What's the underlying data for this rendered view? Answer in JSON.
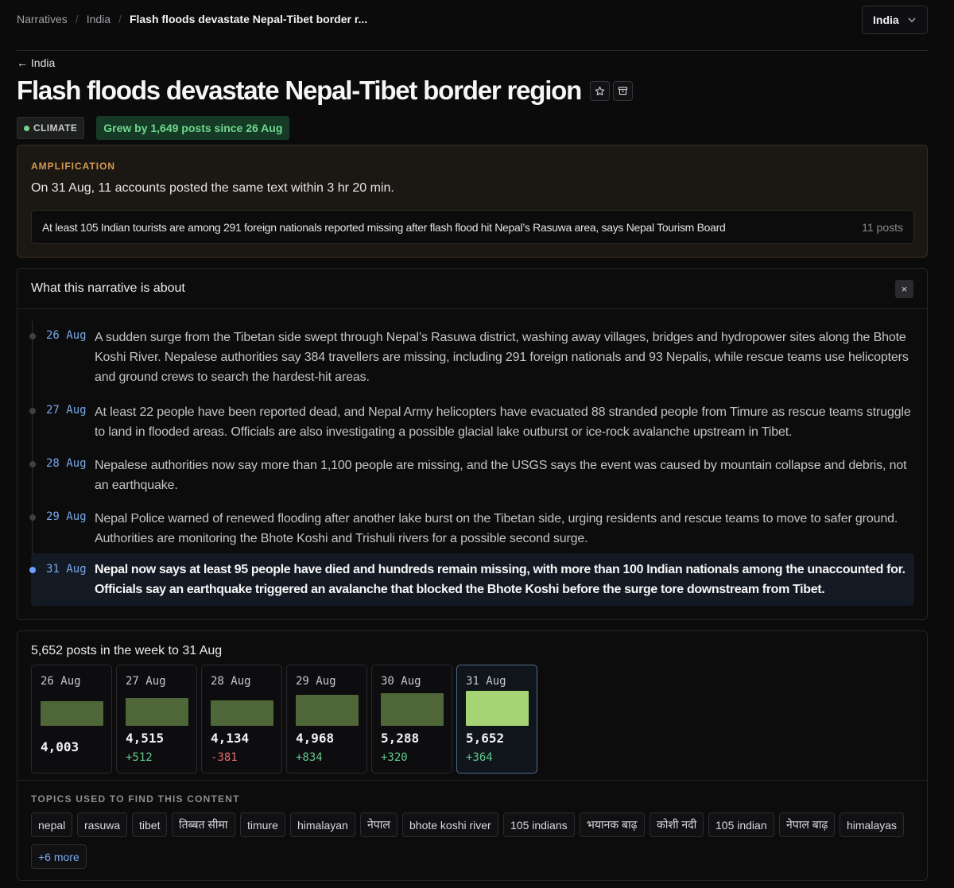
{
  "breadcrumb": {
    "root": "Narratives",
    "parent": "India",
    "current": "Flash floods devastate Nepal-Tibet border r..."
  },
  "country_select": {
    "value": "India"
  },
  "back_link": "← India",
  "title": "Flash floods devastate Nepal-Tibet border region",
  "category": "CLIMATE",
  "growth": "Grew by 1,649 posts since 26 Aug",
  "amplification": {
    "label": "AMPLIFICATION",
    "summary": "On 31 Aug, 11 accounts posted the same text within 3 hr 20 min.",
    "post_text": "At least 105 Indian tourists are among 291 foreign nationals reported missing after flash flood hit Nepal’s Rasuwa area, says Nepal Tourism Board",
    "post_count": "11 posts"
  },
  "about": {
    "title": "What this narrative is about",
    "close": "×",
    "timeline": [
      {
        "date": "26 Aug",
        "text": "A sudden surge from the Tibetan side swept through Nepal’s Rasuwa district, washing away villages, bridges and hydropower sites along the Bhote Koshi River. Nepalese authorities say 384 travellers are missing, including 291 foreign nationals and 93 Nepalis, while rescue teams use helicopters and ground crews to search the hardest-hit areas."
      },
      {
        "date": "27 Aug",
        "text": "At least 22 people have been reported dead, and Nepal Army helicopters have evacuated 88 stranded people from Timure as rescue teams struggle to land in flooded areas. Officials are also investigating a possible glacial lake outburst or ice-rock avalanche upstream in Tibet."
      },
      {
        "date": "28 Aug",
        "text": "Nepalese authorities now say more than 1,100 people are missing, and the USGS says the event was caused by mountain collapse and debris, not an earthquake."
      },
      {
        "date": "29 Aug",
        "text": "Nepal Police warned of renewed flooding after another lake burst on the Tibetan side, urging residents and rescue teams to move to safer ground. Authorities are monitoring the Bhote Koshi and Trishuli rivers for a possible second surge."
      },
      {
        "date": "31 Aug",
        "text": "Nepal now says at least 95 people have died and hundreds remain missing, with more than 100 Indian nationals among the unaccounted for. Officials say an earthquake triggered an avalanche that blocked the Bhote Koshi before the surge tore downstream from Tibet."
      }
    ]
  },
  "posts": {
    "title": "5,652 posts in the week to 31 Aug",
    "days": [
      {
        "date": "26 Aug",
        "count": 4003,
        "count_label": "4,003",
        "delta": ""
      },
      {
        "date": "27 Aug",
        "count": 4515,
        "count_label": "4,515",
        "delta": "+512"
      },
      {
        "date": "28 Aug",
        "count": 4134,
        "count_label": "4,134",
        "delta": "-381"
      },
      {
        "date": "29 Aug",
        "count": 4968,
        "count_label": "4,968",
        "delta": "+834"
      },
      {
        "date": "30 Aug",
        "count": 5288,
        "count_label": "5,288",
        "delta": "+320"
      },
      {
        "date": "31 Aug",
        "count": 5652,
        "count_label": "5,652",
        "delta": "+364"
      }
    ]
  },
  "topics": {
    "label": "TOPICS USED TO FIND THIS CONTENT",
    "items": [
      "nepal",
      "rasuwa",
      "tibet",
      "तिब्बत सीमा",
      "timure",
      "himalayan",
      "नेपाल",
      "bhote koshi river",
      "105 indians",
      "भयानक बाढ़",
      "कोशी नदी",
      "105 indian",
      "नेपाल बाढ़",
      "himalayas"
    ],
    "more": "+6 more"
  },
  "colors": {
    "accent_blue": "#6aa0ff",
    "growth_green": "#6fd88e",
    "amplification_orange": "#d69a52",
    "bar": "#4f6638",
    "bar_active": "#a6d474",
    "delta_negative": "#e06a6a"
  },
  "icons": {
    "star": "star-icon",
    "archive": "archive-icon",
    "chevron": "chevron-down-icon",
    "close": "close-icon"
  }
}
